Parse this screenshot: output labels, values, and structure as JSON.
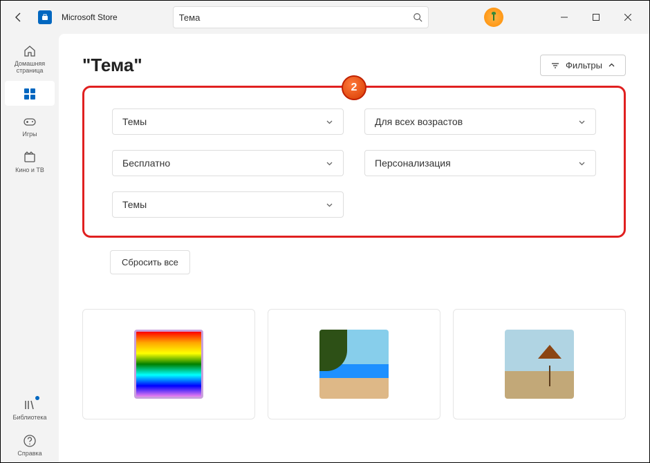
{
  "titlebar": {
    "app_title": "Microsoft Store",
    "search_value": "Тема"
  },
  "sidebar": {
    "home": "Домашняя страница",
    "apps": "",
    "games": "Игры",
    "movies": "Кино и ТВ",
    "library": "Библиотека",
    "help": "Справка"
  },
  "main": {
    "page_title": "\"Тема\"",
    "filters_label": "Фильтры",
    "step_number": "2",
    "filters": {
      "category": "Темы",
      "age": "Для всех возрастов",
      "price": "Бесплатно",
      "dept": "Персонализация",
      "sub": "Темы"
    },
    "reset_label": "Сбросить все"
  }
}
